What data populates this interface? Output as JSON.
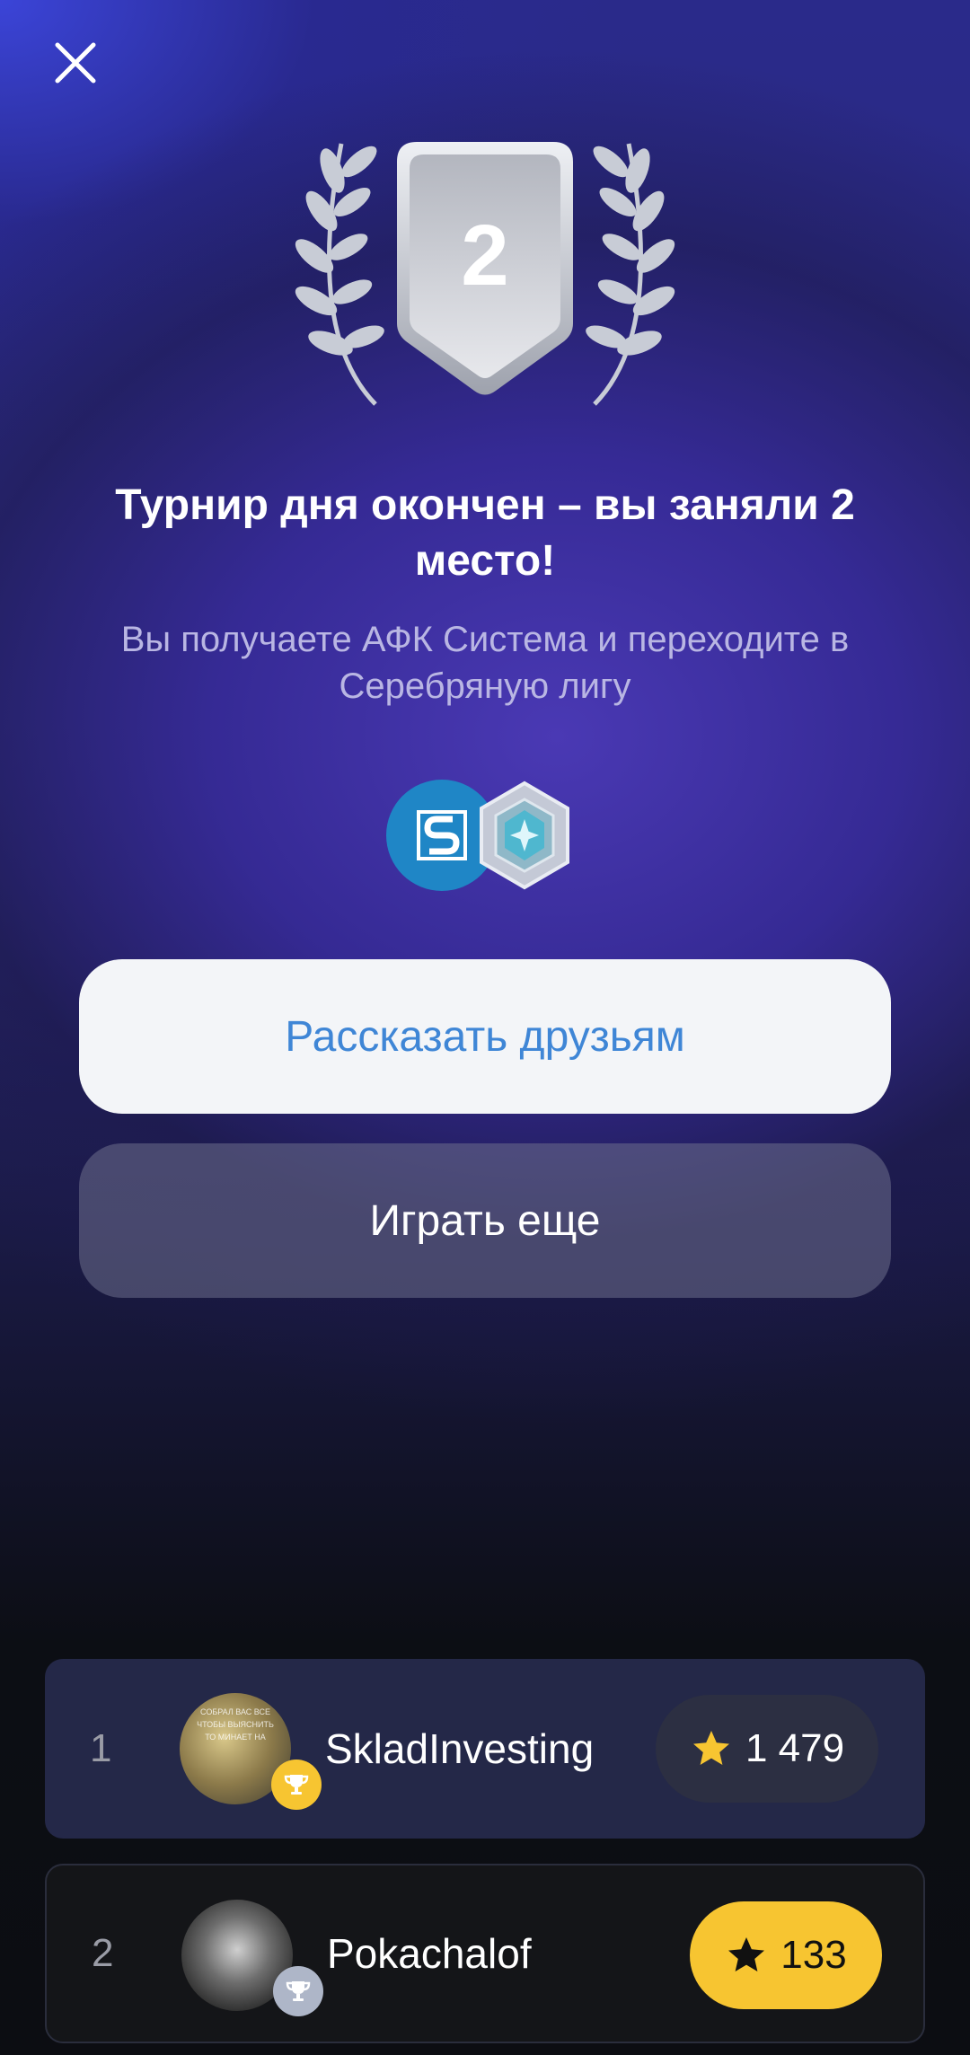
{
  "header": {
    "close_icon": "close-icon"
  },
  "result": {
    "place": "2",
    "title": "Турнир дня окончен – вы заняли 2 место!",
    "subtitle": "Вы получаете АФК Система и переходите в Серебряную лигу"
  },
  "rewards": [
    {
      "icon": "afk-sistema-logo",
      "letter": "S"
    },
    {
      "icon": "silver-league-badge-icon"
    }
  ],
  "buttons": {
    "share_label": "Рассказать друзьям",
    "play_label": "Играть еще"
  },
  "leaderboard": [
    {
      "rank": "1",
      "name": "SkladInvesting",
      "score": "1 479",
      "avatar_text": "СОБРАЛ ВАС ВСЕ ЧТОБЫ ВЫЯСНИТЬ ТО МИНАЕТ НА"
    },
    {
      "rank": "2",
      "name": "Pokachalof",
      "score": "133"
    }
  ],
  "colors": {
    "accent_blue": "#3f86d6",
    "star_gold": "#f7c531",
    "silver": "#c4c7d0"
  }
}
